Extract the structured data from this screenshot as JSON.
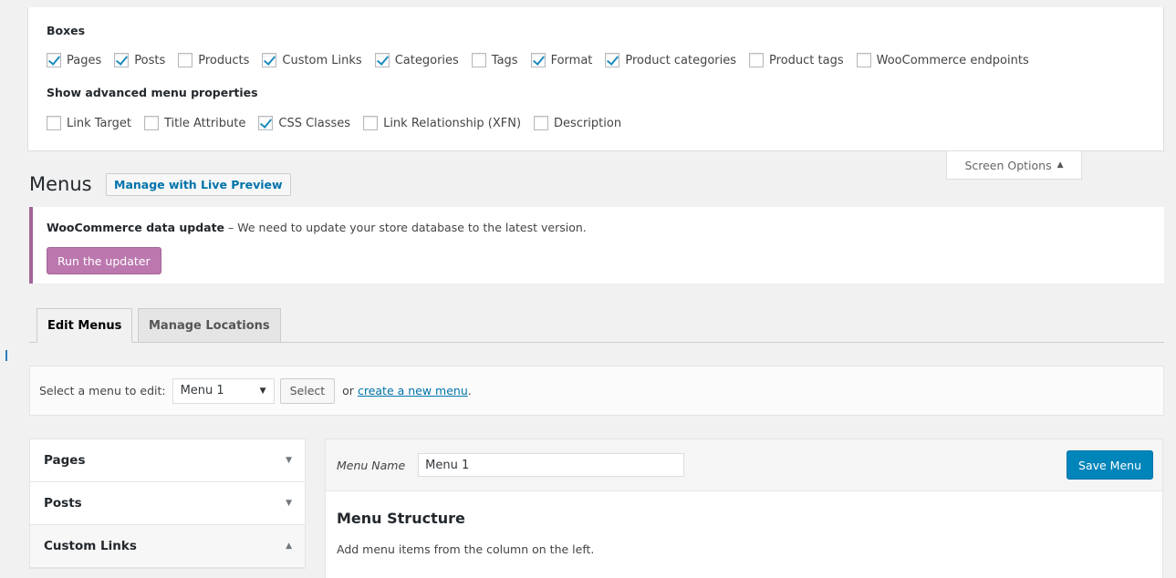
{
  "screen_options": {
    "boxes_heading": "Boxes",
    "boxes": [
      {
        "label": "Pages",
        "checked": true
      },
      {
        "label": "Posts",
        "checked": true
      },
      {
        "label": "Products",
        "checked": false
      },
      {
        "label": "Custom Links",
        "checked": true
      },
      {
        "label": "Categories",
        "checked": true
      },
      {
        "label": "Tags",
        "checked": false
      },
      {
        "label": "Format",
        "checked": true
      },
      {
        "label": "Product categories",
        "checked": true
      },
      {
        "label": "Product tags",
        "checked": false
      },
      {
        "label": "WooCommerce endpoints",
        "checked": false
      }
    ],
    "advanced_heading": "Show advanced menu properties",
    "advanced": [
      {
        "label": "Link Target",
        "checked": false
      },
      {
        "label": "Title Attribute",
        "checked": false
      },
      {
        "label": "CSS Classes",
        "checked": true
      },
      {
        "label": "Link Relationship (XFN)",
        "checked": false
      },
      {
        "label": "Description",
        "checked": false
      }
    ],
    "tab_label": "Screen Options"
  },
  "page": {
    "title": "Menus",
    "live_preview_label": "Manage with Live Preview"
  },
  "notice": {
    "bold": "WooCommerce data update",
    "text": " – We need to update your store database to the latest version.",
    "button_label": "Run the updater"
  },
  "tabs": {
    "edit": "Edit Menus",
    "locations": "Manage Locations"
  },
  "select_bar": {
    "label": "Select a menu to edit:",
    "selected": "Menu 1",
    "select_button": "Select",
    "or_text": "or",
    "create_link": "create a new menu",
    "period": "."
  },
  "accordion": [
    {
      "label": "Pages",
      "open": false
    },
    {
      "label": "Posts",
      "open": false
    },
    {
      "label": "Custom Links",
      "open": true
    }
  ],
  "menu_editor": {
    "name_label": "Menu Name",
    "name_value": "Menu 1",
    "save_label": "Save Menu",
    "structure_title": "Menu Structure",
    "structure_desc": "Add menu items from the column on the left."
  },
  "colors": {
    "accent": "#0085ba",
    "woo_purple": "#bb77ae",
    "checkmark": "#1e8cbe"
  }
}
